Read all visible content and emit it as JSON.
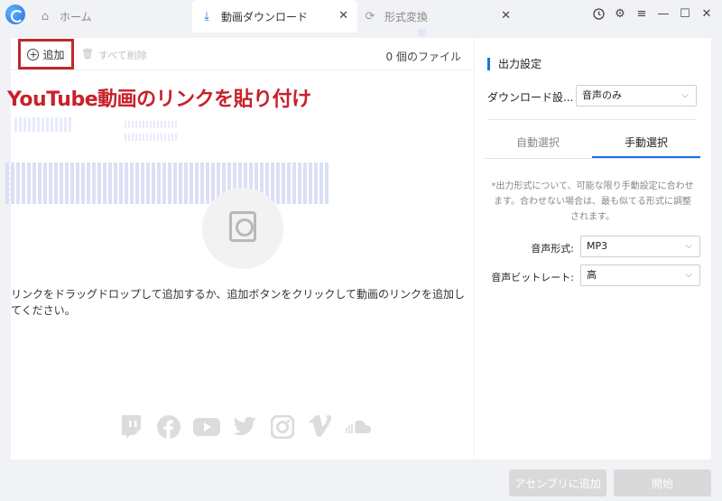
{
  "tabs": {
    "home": "ホーム",
    "download": "動画ダウンロード",
    "convert": "形式変換",
    "download_ghost": "動画ダウンロード"
  },
  "toolbar": {
    "add_label": "追加",
    "delete_all_label": "すべて削除",
    "file_count": "0 個のファイル"
  },
  "overlay": {
    "title": "YouTube動画のリンクを貼り付け"
  },
  "drop_hint": "リンクをドラッグドロップして追加するか、追加ボタンをクリックして動画のリンクを追加してください。",
  "social_icons": [
    "twitch-icon",
    "facebook-icon",
    "youtube-icon",
    "twitter-icon",
    "instagram-icon",
    "vimeo-icon",
    "soundcloud-icon"
  ],
  "output": {
    "title": "出力設定",
    "download_setting_label": "ダウンロード設...",
    "download_setting_value": "音声のみ",
    "tab_auto": "自動選択",
    "tab_manual": "手動選択",
    "note": "*出力形式について、可能な限り手動設定に合わせます。合わせない場合は、最も似てる形式に調整されます。",
    "audio_format_label": "音声形式:",
    "audio_format_value": "MP3",
    "bitrate_label": "音声ビットレート:",
    "bitrate_value": "高"
  },
  "buttons": {
    "assembly": "アセンブリに追加",
    "start": "開始"
  },
  "colors": {
    "accent": "#1e6fe6",
    "highlight_red": "#c8212a",
    "disabled_button": "#d9d9d9"
  }
}
